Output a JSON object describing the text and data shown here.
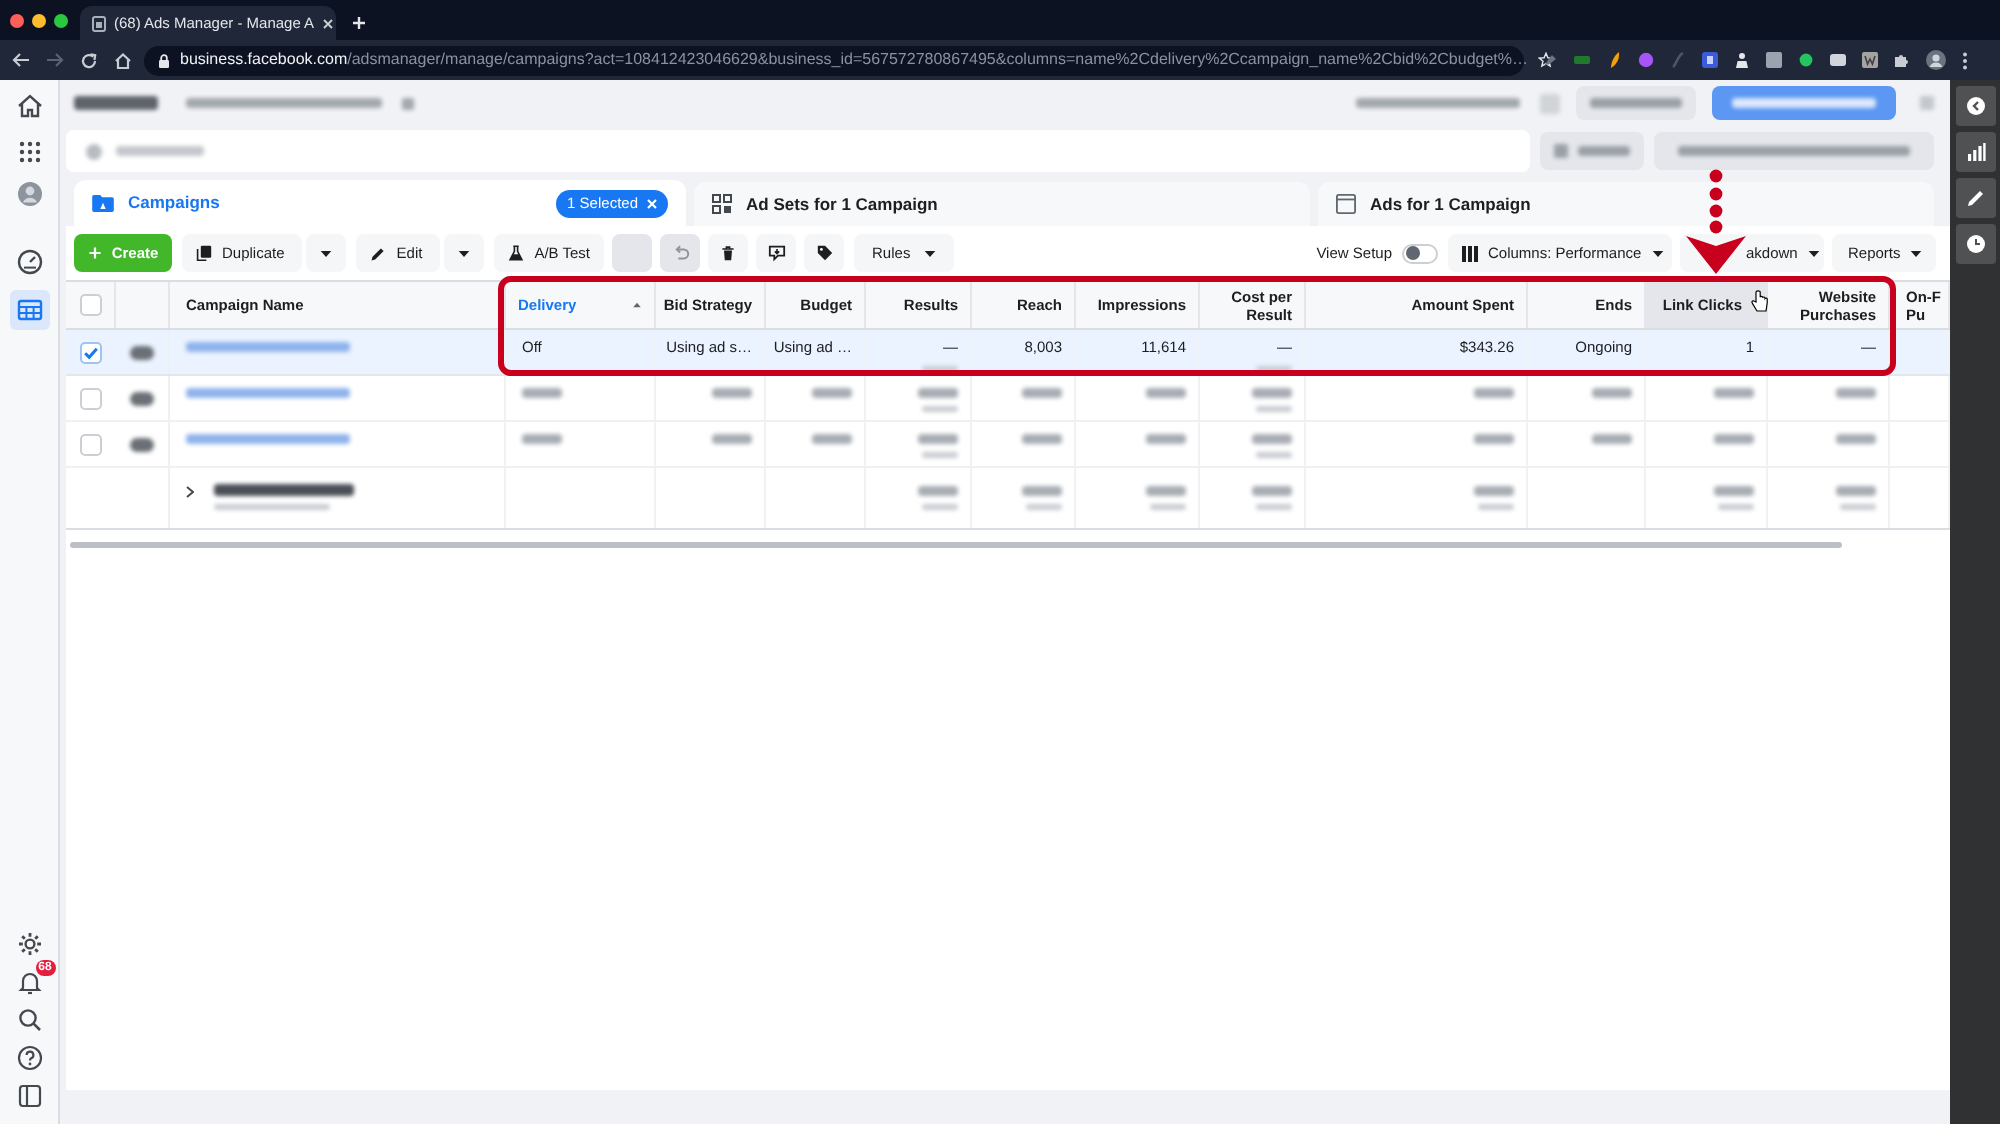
{
  "browser": {
    "tab_title": "(68) Ads Manager - Manage A",
    "url_host": "business.facebook.com",
    "url_path": "/adsmanager/manage/campaigns?act=108412423046629&business_id=567572780867495&columns=name%2Cdelivery%2Ccampaign_name%2Cbid%2Cbudget%…"
  },
  "sidebar": {
    "items": [
      {
        "selected": false
      },
      {
        "selected": false
      },
      {
        "selected": false
      },
      {
        "selected": false
      },
      {
        "selected": true
      }
    ],
    "notification_badge": "68"
  },
  "tabs": [
    {
      "label": "Campaigns",
      "selected": true,
      "badge": "1 Selected"
    },
    {
      "label": "Ad Sets for 1 Campaign",
      "selected": false
    },
    {
      "label": "Ads for 1 Campaign",
      "selected": false
    }
  ],
  "toolbar": {
    "actions": [
      {
        "kind": "create",
        "label": "Create"
      },
      {
        "kind": "split",
        "label": "Duplicate"
      },
      {
        "kind": "split",
        "label": "Edit"
      },
      {
        "kind": "button",
        "label": "A/B Test"
      },
      {
        "kind": "icon",
        "disabled": true
      },
      {
        "kind": "icon",
        "disabled": true
      },
      {
        "kind": "icon",
        "disabled": false
      },
      {
        "kind": "icon",
        "disabled": false
      },
      {
        "kind": "icon",
        "disabled": false
      },
      {
        "kind": "menu",
        "label": "Rules"
      }
    ],
    "view_setup": {
      "label": "View Setup",
      "on": false
    },
    "menus": [
      {
        "kind": "columns",
        "label": "Columns: Performance"
      },
      {
        "kind": "breakdown",
        "label": "akdown"
      },
      {
        "kind": "plain",
        "label": "Reports"
      }
    ]
  },
  "table": {
    "select_all": {
      "checked": false
    },
    "columns": [
      {
        "label": "Campaign Name",
        "kind": "text",
        "sorted": false,
        "hovered": false
      },
      {
        "label": "Delivery",
        "kind": "text",
        "sorted": true,
        "hovered": false
      },
      {
        "label": "Bid Strategy",
        "kind": "number",
        "sorted": false,
        "hovered": false
      },
      {
        "label": "Budget",
        "kind": "number",
        "sorted": false,
        "hovered": false
      },
      {
        "label": "Results",
        "kind": "number",
        "sorted": false,
        "hovered": false
      },
      {
        "label": "Reach",
        "kind": "number",
        "sorted": false,
        "hovered": false
      },
      {
        "label": "Impressions",
        "kind": "number",
        "sorted": false,
        "hovered": false
      },
      {
        "label": "Cost per Result",
        "kind": "number",
        "sorted": false,
        "hovered": false
      },
      {
        "label": "Amount Spent",
        "kind": "number",
        "sorted": false,
        "hovered": false
      },
      {
        "label": "Ends",
        "kind": "number",
        "sorted": false,
        "hovered": false
      },
      {
        "label": "Link Clicks",
        "kind": "number",
        "sorted": false,
        "hovered": true
      },
      {
        "label": "Website Purchases",
        "kind": "number",
        "sorted": false,
        "hovered": false
      },
      {
        "label": "On-F Pu",
        "kind": "text",
        "sorted": false,
        "hovered": false
      }
    ],
    "rows": [
      {
        "kind": "campaign",
        "selected": true,
        "checked": true,
        "cells": [
          {
            "kind": "blurred"
          },
          {
            "kind": "text",
            "text": "Off"
          },
          {
            "kind": "text",
            "text": "Using ad s…"
          },
          {
            "kind": "text",
            "text": "Using ad …"
          },
          {
            "kind": "captioned",
            "text": "—"
          },
          {
            "kind": "text",
            "text": "8,003"
          },
          {
            "kind": "text",
            "text": "11,614"
          },
          {
            "kind": "captioned",
            "text": "—"
          },
          {
            "kind": "text",
            "text": "$343.26"
          },
          {
            "kind": "text",
            "text": "Ongoing"
          },
          {
            "kind": "text",
            "text": "1"
          },
          {
            "kind": "text",
            "text": "—"
          },
          {
            "kind": "empty"
          }
        ]
      },
      {
        "kind": "campaign",
        "selected": false,
        "checked": false,
        "cells": [
          {
            "kind": "blurred"
          },
          {
            "kind": "blurred"
          },
          {
            "kind": "blurred"
          },
          {
            "kind": "blurred"
          },
          {
            "kind": "stacked"
          },
          {
            "kind": "blurred"
          },
          {
            "kind": "blurred"
          },
          {
            "kind": "stacked"
          },
          {
            "kind": "blurred"
          },
          {
            "kind": "blurred"
          },
          {
            "kind": "blurred"
          },
          {
            "kind": "blurred"
          },
          {
            "kind": "empty"
          }
        ]
      },
      {
        "kind": "campaign",
        "selected": false,
        "checked": false,
        "cells": [
          {
            "kind": "blurred"
          },
          {
            "kind": "blurred"
          },
          {
            "kind": "blurred"
          },
          {
            "kind": "blurred"
          },
          {
            "kind": "stacked"
          },
          {
            "kind": "blurred"
          },
          {
            "kind": "blurred"
          },
          {
            "kind": "stacked"
          },
          {
            "kind": "blurred"
          },
          {
            "kind": "blurred"
          },
          {
            "kind": "blurred"
          },
          {
            "kind": "blurred"
          },
          {
            "kind": "empty"
          }
        ]
      },
      {
        "kind": "summary",
        "selected": false,
        "cells": [
          {
            "kind": "stacked"
          },
          {
            "kind": "empty"
          },
          {
            "kind": "empty"
          },
          {
            "kind": "empty"
          },
          {
            "kind": "stacked"
          },
          {
            "kind": "stacked"
          },
          {
            "kind": "stacked"
          },
          {
            "kind": "stacked"
          },
          {
            "kind": "stacked"
          },
          {
            "kind": "empty"
          },
          {
            "kind": "stacked"
          },
          {
            "kind": "stacked"
          },
          {
            "kind": "empty"
          }
        ]
      }
    ]
  }
}
